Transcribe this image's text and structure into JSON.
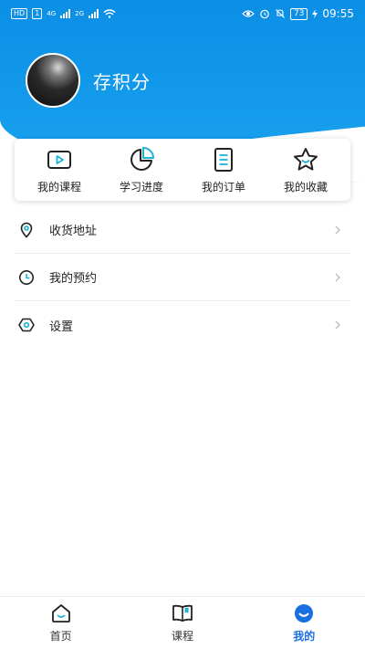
{
  "status_bar": {
    "hd": "HD",
    "sim": "1",
    "net1": "4G",
    "net2": "2G",
    "battery": "73",
    "time": "09:55"
  },
  "profile": {
    "name": "存积分"
  },
  "quick_actions": [
    {
      "label": "我的课程",
      "icon": "video-play-icon"
    },
    {
      "label": "学习进度",
      "icon": "pie-chart-icon"
    },
    {
      "label": "我的订单",
      "icon": "order-list-icon"
    },
    {
      "label": "我的收藏",
      "icon": "star-icon"
    }
  ],
  "menu": [
    {
      "label": "收货地址",
      "icon": "location-pin-icon"
    },
    {
      "label": "我的预约",
      "icon": "clock-icon"
    },
    {
      "label": "设置",
      "icon": "settings-hexagon-icon"
    }
  ],
  "tabbar": [
    {
      "label": "首页",
      "icon": "home-icon",
      "active": false
    },
    {
      "label": "课程",
      "icon": "book-icon",
      "active": false
    },
    {
      "label": "我的",
      "icon": "profile-icon",
      "active": true
    }
  ],
  "colors": {
    "header": "#1aa3ef",
    "accent": "#1a6fe0",
    "icon_teal": "#1bb3d6"
  }
}
